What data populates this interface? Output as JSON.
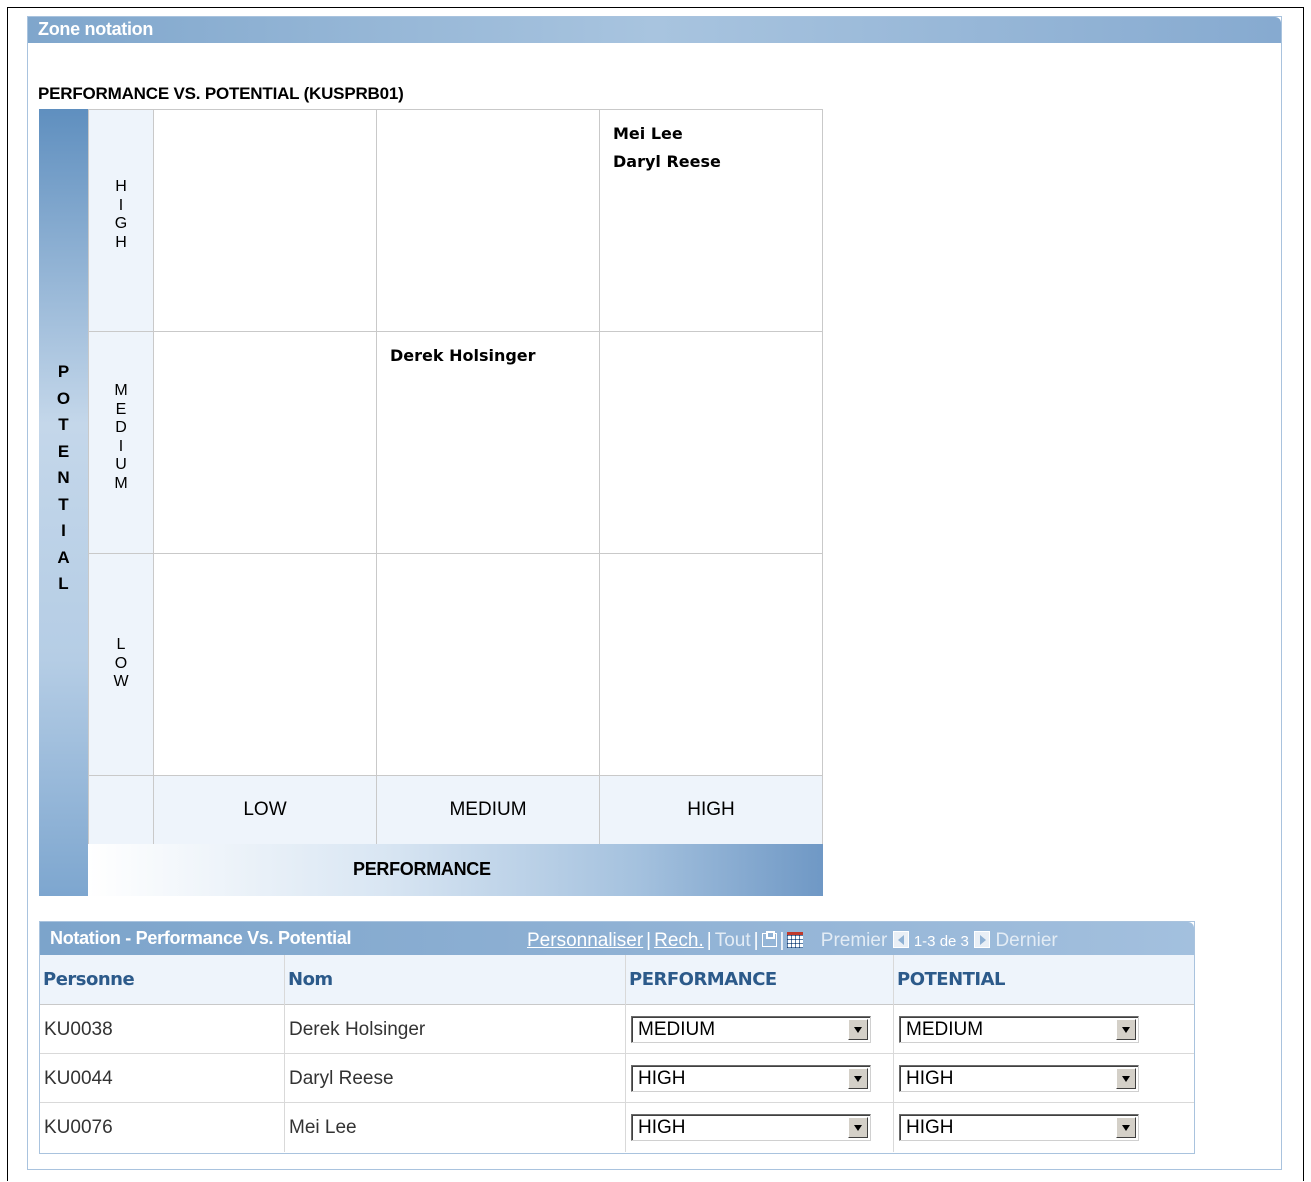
{
  "section": {
    "title": "Zone notation"
  },
  "grid": {
    "title": "PERFORMANCE VS. POTENTIAL (KUSPRB01)",
    "y_axis_label": "P\nO\nT\nE\nN\nT\nI\nA\nL",
    "x_axis_label": "PERFORMANCE",
    "row_labels": [
      "H\nI\nG\nH",
      "M\nE\nD\nI\nU\nM",
      "L\nO\nW"
    ],
    "col_labels": [
      "LOW",
      "MEDIUM",
      "HIGH"
    ],
    "cells": {
      "high_high": "Mei Lee\nDaryl Reese",
      "medium_medium": "Derek Holsinger"
    }
  },
  "table": {
    "title": "Notation - Performance Vs. Potential",
    "nav": {
      "personalize": "Personnaliser",
      "find": "Rech.",
      "view_all": "Tout",
      "first": "Premier",
      "range": "1-3 de 3",
      "last": "Dernier"
    },
    "columns": [
      "Personne",
      "Nom",
      "PERFORMANCE",
      "POTENTIAL"
    ],
    "rows": [
      {
        "id": "KU0038",
        "name": "Derek Holsinger",
        "performance": "MEDIUM",
        "potential": "MEDIUM"
      },
      {
        "id": "KU0044",
        "name": "Daryl Reese",
        "performance": "HIGH",
        "potential": "HIGH"
      },
      {
        "id": "KU0076",
        "name": "Mei Lee",
        "performance": "HIGH",
        "potential": "HIGH"
      }
    ]
  }
}
